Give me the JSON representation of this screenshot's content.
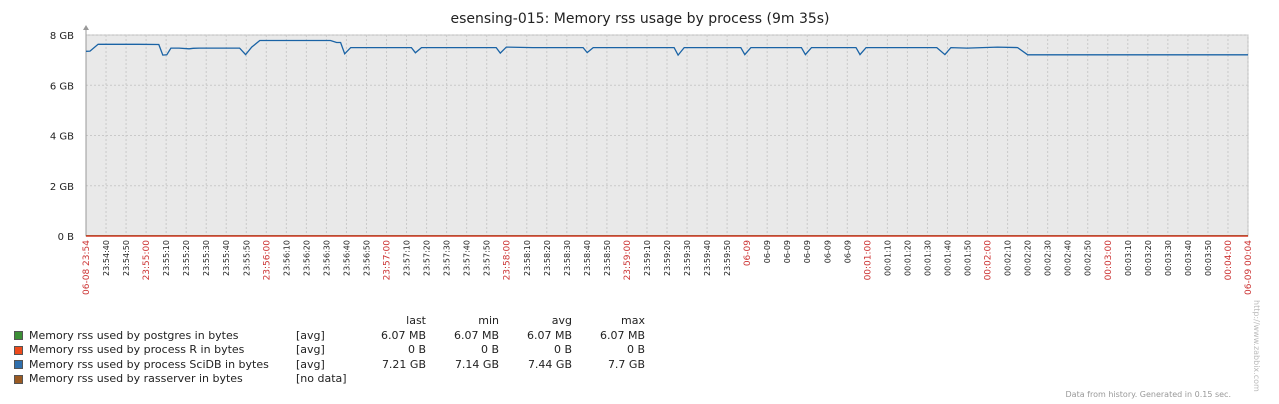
{
  "chart_data": {
    "type": "line",
    "title": "esensing-015: Memory rss usage by process (9m 35s)",
    "y_ticks": [
      "8 GB",
      "6 GB",
      "4 GB",
      "2 GB",
      "0 B"
    ],
    "ylim": [
      0,
      8
    ],
    "y_unit": "GB",
    "grid": true,
    "x_ticks": [
      {
        "label": "06-08 23:54",
        "major": true
      },
      {
        "label": "23:54:40",
        "major": false
      },
      {
        "label": "23:54:50",
        "major": false
      },
      {
        "label": "23:55:00",
        "major": true
      },
      {
        "label": "23:55:10",
        "major": false
      },
      {
        "label": "23:55:20",
        "major": false
      },
      {
        "label": "23:55:30",
        "major": false
      },
      {
        "label": "23:55:40",
        "major": false
      },
      {
        "label": "23:55:50",
        "major": false
      },
      {
        "label": "23:56:00",
        "major": true
      },
      {
        "label": "23:56:10",
        "major": false
      },
      {
        "label": "23:56:20",
        "major": false
      },
      {
        "label": "23:56:30",
        "major": false
      },
      {
        "label": "23:56:40",
        "major": false
      },
      {
        "label": "23:56:50",
        "major": false
      },
      {
        "label": "23:57:00",
        "major": true
      },
      {
        "label": "23:57:10",
        "major": false
      },
      {
        "label": "23:57:20",
        "major": false
      },
      {
        "label": "23:57:30",
        "major": false
      },
      {
        "label": "23:57:40",
        "major": false
      },
      {
        "label": "23:57:50",
        "major": false
      },
      {
        "label": "23:58:00",
        "major": true
      },
      {
        "label": "23:58:10",
        "major": false
      },
      {
        "label": "23:58:20",
        "major": false
      },
      {
        "label": "23:58:30",
        "major": false
      },
      {
        "label": "23:58:40",
        "major": false
      },
      {
        "label": "23:58:50",
        "major": false
      },
      {
        "label": "23:59:00",
        "major": true
      },
      {
        "label": "23:59:10",
        "major": false
      },
      {
        "label": "23:59:20",
        "major": false
      },
      {
        "label": "23:59:30",
        "major": false
      },
      {
        "label": "23:59:40",
        "major": false
      },
      {
        "label": "23:59:50",
        "major": false
      },
      {
        "label": "06-09",
        "major": true
      },
      {
        "label": "06-09",
        "major": false
      },
      {
        "label": "06-09",
        "major": false
      },
      {
        "label": "06-09",
        "major": false
      },
      {
        "label": "06-09",
        "major": false
      },
      {
        "label": "06-09",
        "major": false
      },
      {
        "label": "00:01:00",
        "major": true
      },
      {
        "label": "00:01:10",
        "major": false
      },
      {
        "label": "00:01:20",
        "major": false
      },
      {
        "label": "00:01:30",
        "major": false
      },
      {
        "label": "00:01:40",
        "major": false
      },
      {
        "label": "00:01:50",
        "major": false
      },
      {
        "label": "00:02:00",
        "major": true
      },
      {
        "label": "00:02:10",
        "major": false
      },
      {
        "label": "00:02:20",
        "major": false
      },
      {
        "label": "00:02:30",
        "major": false
      },
      {
        "label": "00:02:40",
        "major": false
      },
      {
        "label": "00:02:50",
        "major": false
      },
      {
        "label": "00:03:00",
        "major": true
      },
      {
        "label": "00:03:10",
        "major": false
      },
      {
        "label": "00:03:20",
        "major": false
      },
      {
        "label": "00:03:30",
        "major": false
      },
      {
        "label": "00:03:40",
        "major": false
      },
      {
        "label": "00:03:50",
        "major": false
      },
      {
        "label": "00:04:00",
        "major": true
      },
      {
        "label": "06-09 00:04",
        "major": true
      }
    ],
    "series": [
      {
        "name": "Memory rss used by process SciDB in bytes",
        "color": "#1a63a5",
        "x": [
          "23:54:34",
          "23:54:36",
          "23:54:40",
          "23:54:45",
          "23:54:50",
          "23:55:00",
          "23:55:10",
          "23:55:12",
          "23:55:14",
          "23:55:16",
          "23:55:20",
          "23:55:25",
          "23:55:27",
          "23:55:30",
          "23:55:50",
          "23:55:53",
          "23:55:56",
          "23:56:00",
          "23:56:10",
          "23:56:30",
          "23:56:35",
          "23:56:38",
          "23:56:40",
          "23:56:42",
          "23:56:45",
          "23:56:50",
          "23:57:15",
          "23:57:17",
          "23:57:20",
          "23:57:25",
          "23:57:35",
          "23:57:45",
          "23:57:57",
          "23:57:59",
          "23:58:02",
          "23:58:15",
          "23:58:30",
          "23:58:40",
          "23:58:42",
          "23:58:45",
          "23:58:55",
          "23:59:05",
          "23:59:15",
          "23:59:25",
          "23:59:27",
          "23:59:30",
          "23:59:37",
          "23:59:40",
          "23:59:45",
          "23:59:58",
          "00:00:00",
          "00:00:03",
          "00:00:15",
          "00:00:28",
          "00:00:30",
          "00:00:33",
          "00:00:45",
          "00:00:55",
          "00:00:57",
          "00:01:00",
          "00:01:15",
          "00:01:25",
          "00:01:35",
          "00:01:39",
          "00:01:42",
          "00:01:50",
          "00:02:05",
          "00:02:15",
          "00:02:20",
          "00:02:30",
          "00:03:00",
          "00:03:30",
          "00:04:00",
          "00:04:09"
        ],
        "values": [
          7.35,
          7.36,
          7.63,
          7.63,
          7.63,
          7.63,
          7.62,
          7.2,
          7.21,
          7.48,
          7.48,
          7.45,
          7.47,
          7.48,
          7.48,
          7.22,
          7.52,
          7.78,
          7.78,
          7.78,
          7.78,
          7.7,
          7.7,
          7.25,
          7.5,
          7.5,
          7.5,
          7.29,
          7.5,
          7.5,
          7.5,
          7.5,
          7.5,
          7.28,
          7.52,
          7.5,
          7.5,
          7.5,
          7.3,
          7.5,
          7.5,
          7.5,
          7.5,
          7.5,
          7.2,
          7.5,
          7.5,
          7.5,
          7.5,
          7.5,
          7.22,
          7.5,
          7.5,
          7.5,
          7.22,
          7.5,
          7.5,
          7.5,
          7.22,
          7.5,
          7.5,
          7.5,
          7.5,
          7.22,
          7.5,
          7.48,
          7.52,
          7.5,
          7.21,
          7.21,
          7.21,
          7.21,
          7.21,
          7.21
        ]
      },
      {
        "name": "Memory rss used by postgres in bytes",
        "color": "#3c8f36",
        "x": [
          "23:54:34",
          "00:04:09"
        ],
        "values": [
          0.0061,
          0.0061
        ]
      },
      {
        "name": "Memory rss used by process R in bytes",
        "color": "#ee4a1b",
        "x": [
          "23:54:34",
          "00:04:09"
        ],
        "values": [
          0,
          0
        ]
      }
    ]
  },
  "legend": {
    "headers": {
      "last": "last",
      "min": "min",
      "avg": "avg",
      "max": "max"
    },
    "rows": [
      {
        "name": "Memory rss used by postgres in bytes",
        "color": "#3c8f36",
        "func": "[avg]",
        "last": "6.07 MB",
        "min": "6.07 MB",
        "avg": "6.07 MB",
        "max": "6.07 MB"
      },
      {
        "name": "Memory rss used by process R in bytes",
        "color": "#ee4a1b",
        "func": "[avg]",
        "last": "0 B",
        "min": "0 B",
        "avg": "0 B",
        "max": "0 B"
      },
      {
        "name": "Memory rss used by process SciDB in bytes",
        "color": "#2f6fad",
        "func": "[avg]",
        "last": "7.21 GB",
        "min": "7.14 GB",
        "avg": "7.44 GB",
        "max": "7.7 GB"
      },
      {
        "name": "Memory rss used by rasserver in bytes",
        "color": "#9a5a22",
        "func": "[no data]",
        "last": "",
        "min": "",
        "avg": "",
        "max": ""
      }
    ]
  },
  "footer": "Data from history. Generated in 0.15 sec.",
  "watermark": "http://www.zabbix.com",
  "colors": {
    "plot_bg": "#e9e9e9",
    "grid": "#c9c9c9",
    "major_tick_text": "#cc3333",
    "tick_text": "#222222",
    "zero_line": "#d0281c"
  }
}
